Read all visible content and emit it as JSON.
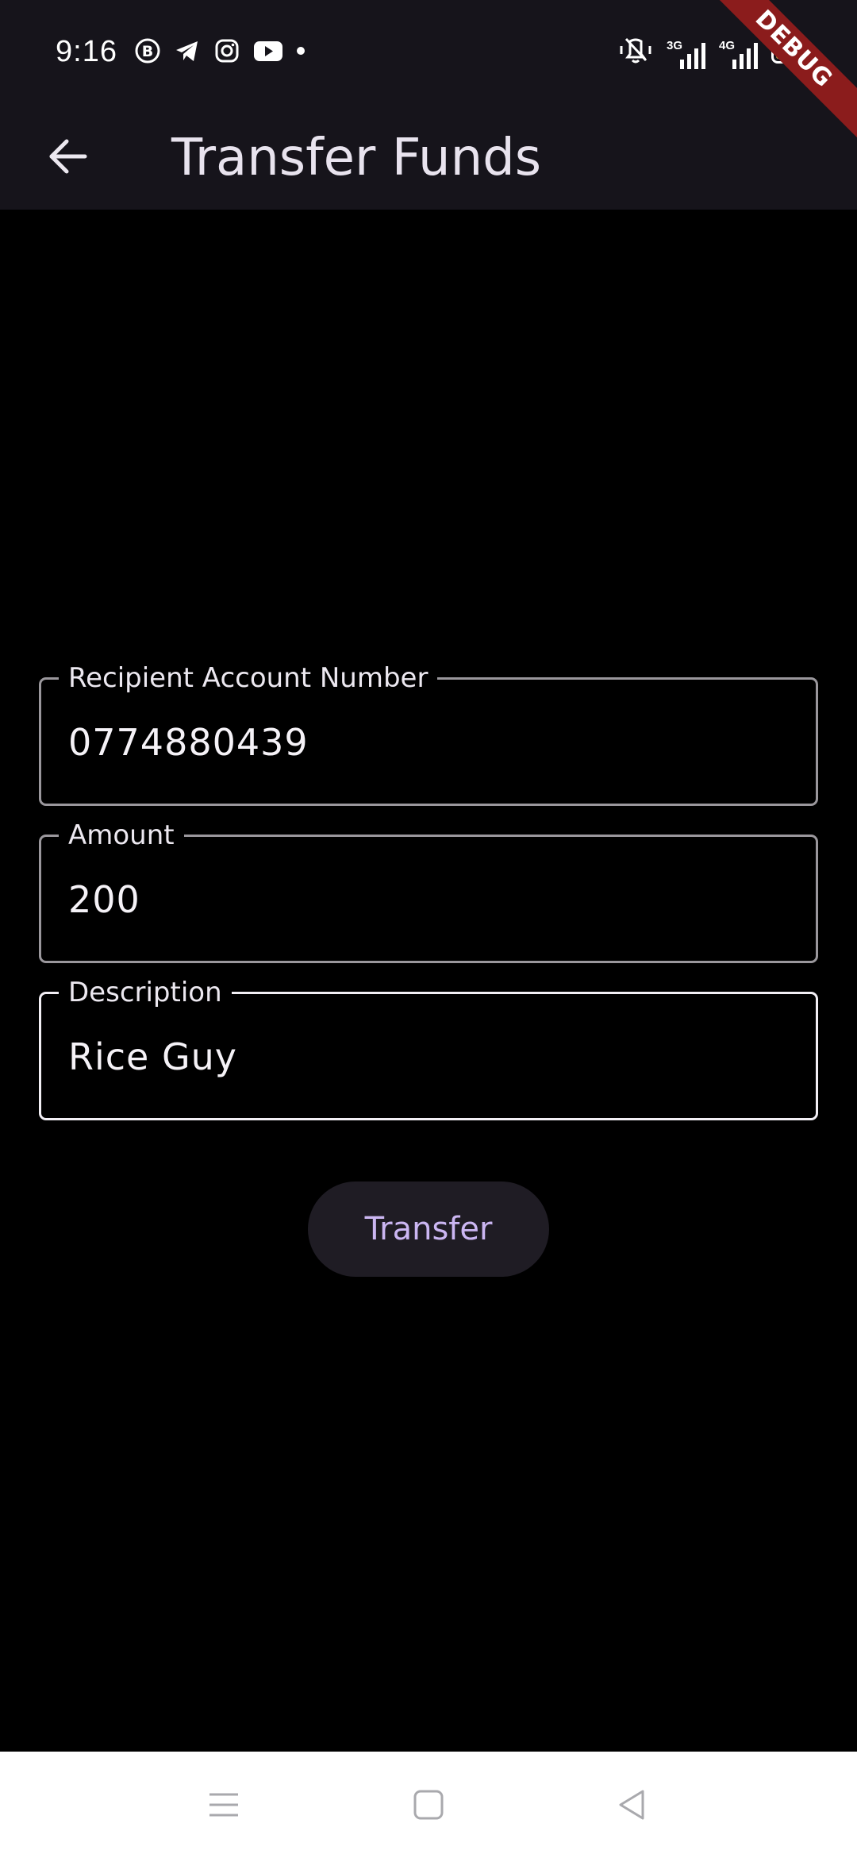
{
  "status_bar": {
    "time": "9:16",
    "left_icons": [
      "b-circle-icon",
      "telegram-icon",
      "instagram-icon",
      "youtube-icon",
      "dot-icon"
    ],
    "right_icons": [
      "vibrate-mute-icon",
      "signal-3g-icon",
      "signal-4g-icon",
      "battery-icon"
    ],
    "network_1": "3G",
    "network_2": "4G",
    "battery_level": 0.2
  },
  "debug_banner": "DEBUG",
  "app_bar": {
    "title": "Transfer Funds",
    "back_icon": "arrow-back-icon"
  },
  "form": {
    "recipient": {
      "label": "Recipient Account Number",
      "value": "0774880439"
    },
    "amount": {
      "label": "Amount",
      "value": "200"
    },
    "description": {
      "label": "Description",
      "value": "Rice Guy"
    },
    "submit_label": "Transfer"
  },
  "nav_bar": {
    "buttons": [
      "menu-icon",
      "home-icon",
      "back-triangle-icon"
    ]
  },
  "colors": {
    "background": "#000000",
    "app_bar": "#16141b",
    "accent": "#cbb6f2",
    "debug_banner": "#8b1c1c",
    "battery": "#f2c94c"
  }
}
